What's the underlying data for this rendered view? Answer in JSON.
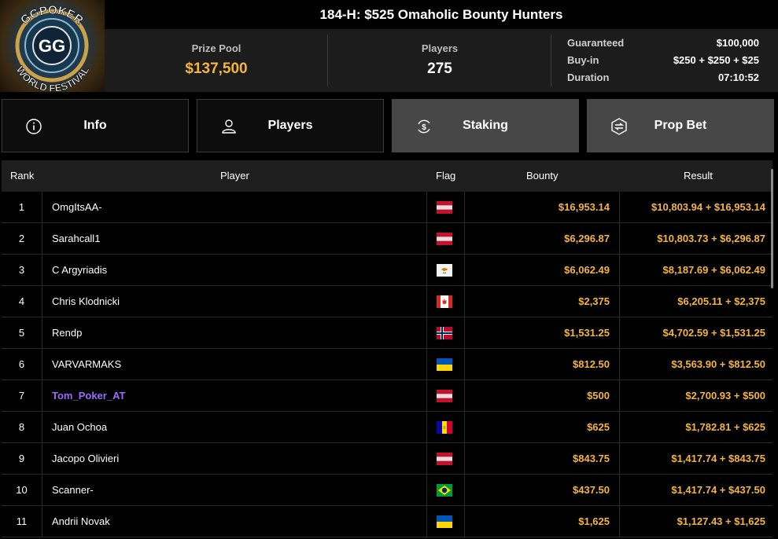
{
  "logo": {
    "text_top": "GGPOKER",
    "text_bottom": "WORLD FESTIVAL",
    "monogram": "GG"
  },
  "tournament": {
    "title": "184-H: $525 Omaholic Bounty Hunters"
  },
  "stats": {
    "prize_pool_label": "Prize Pool",
    "prize_pool_value": "$137,500",
    "players_label": "Players",
    "players_value": "275",
    "guaranteed_label": "Guaranteed",
    "guaranteed_value": "$100,000",
    "buyin_label": "Buy-in",
    "buyin_value": "$250 + $250 + $25",
    "duration_label": "Duration",
    "duration_value": "07:10:52"
  },
  "tabs": [
    {
      "label": "Info",
      "icon": "info-icon",
      "active": false
    },
    {
      "label": "Players",
      "icon": "user-icon",
      "active": false
    },
    {
      "label": "Staking",
      "icon": "coin-exchange-icon",
      "active": true
    },
    {
      "label": "Prop Bet",
      "icon": "prop-bet-icon",
      "active": true
    }
  ],
  "table": {
    "headers": {
      "rank": "Rank",
      "player": "Player",
      "flag": "Flag",
      "bounty": "Bounty",
      "result": "Result"
    },
    "rows": [
      {
        "rank": "1",
        "player": "OmgItsAA-",
        "flag": "austria",
        "bounty": "$16,953.14",
        "result": "$10,803.94 + $16,953.14"
      },
      {
        "rank": "2",
        "player": "Sarahcall1",
        "flag": "austria",
        "bounty": "$6,296.87",
        "result": "$10,803.73 + $6,296.87"
      },
      {
        "rank": "3",
        "player": "C Argyriadis",
        "flag": "cyprus",
        "bounty": "$6,062.49",
        "result": "$8,187.69 + $6,062.49"
      },
      {
        "rank": "4",
        "player": "Chris Klodnicki",
        "flag": "canada",
        "bounty": "$2,375",
        "result": "$6,205.11 + $2,375"
      },
      {
        "rank": "5",
        "player": "Rendp",
        "flag": "norway",
        "bounty": "$1,531.25",
        "result": "$4,702.59 + $1,531.25"
      },
      {
        "rank": "6",
        "player": "VARVARMAKS",
        "flag": "ukraine",
        "bounty": "$812.50",
        "result": "$3,563.90 + $812.50"
      },
      {
        "rank": "7",
        "player": "Tom_Poker_AT",
        "flag": "austria",
        "bounty": "$500",
        "result": "$2,700.93 + $500",
        "highlight": true
      },
      {
        "rank": "8",
        "player": "Juan Ochoa",
        "flag": "andorra",
        "bounty": "$625",
        "result": "$1,782.81 + $625"
      },
      {
        "rank": "9",
        "player": "Jacopo Olivieri",
        "flag": "austria",
        "bounty": "$843.75",
        "result": "$1,417.74 + $843.75"
      },
      {
        "rank": "10",
        "player": "Scanner-",
        "flag": "brazil",
        "bounty": "$437.50",
        "result": "$1,417.74 + $437.50"
      },
      {
        "rank": "11",
        "player": "Andrii Novak",
        "flag": "ukraine",
        "bounty": "$1,625",
        "result": "$1,127.43 + $1,625"
      }
    ]
  },
  "colors": {
    "accent_gold": "#f5b541",
    "highlight_player": "#9b6cff",
    "active_tab": "#474747"
  }
}
